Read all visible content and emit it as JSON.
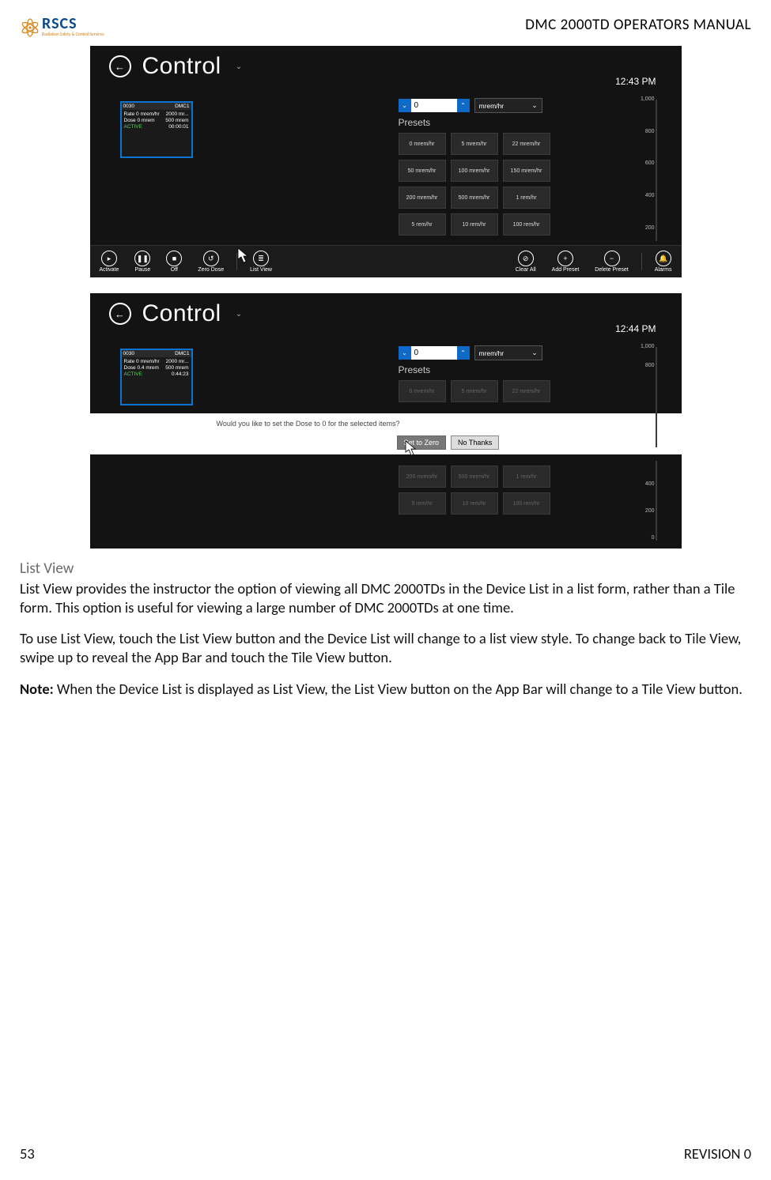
{
  "header": {
    "logo_main": "RSCS",
    "logo_sub": "Radiation Safety & Control Services",
    "doc_title": "DMC 2000TD OPERATORS MANUAL"
  },
  "screens": {
    "s1": {
      "title": "Control",
      "clock": "12:43 PM",
      "device": {
        "id": "0030",
        "model": "DMC1",
        "rate_l": "Rate 0 mrem/hr",
        "rate_r": "2000 mr...",
        "dose_l": "Dose 0 mrem",
        "dose_r": "500 mrem",
        "stat_l": "ACTIVE",
        "stat_r": "00:00:01"
      },
      "spinner_value": "0",
      "unit_value": "mrem/hr",
      "presets_label": "Presets",
      "presets": [
        "0 mrem/hr",
        "5 mrem/hr",
        "22 mrem/hr",
        "50 mrem/hr",
        "100 mrem/hr",
        "150 mrem/hr",
        "200 mrem/hr",
        "500 mrem/hr",
        "1 rem/hr",
        "5 rem/hr",
        "10 rem/hr",
        "100 rem/hr"
      ],
      "axis": [
        "1,000",
        "800",
        "600",
        "400",
        "200"
      ],
      "appbar": {
        "activate": "Activate",
        "pause": "Pause",
        "off": "Off",
        "zero": "Zero Dose",
        "list": "List View",
        "clear": "Clear All",
        "add": "Add Preset",
        "del": "Delete Preset",
        "alarms": "Alarms"
      }
    },
    "s2": {
      "title": "Control",
      "clock": "12:44 PM",
      "device": {
        "id": "0030",
        "model": "DMC1",
        "rate_l": "Rate 0 mrem/hr",
        "rate_r": "2000 mr...",
        "dose_l": "Dose 0.4 mrem",
        "dose_r": "500 mrem",
        "stat_l": "ACTIVE",
        "stat_r": "0:44:23"
      },
      "spinner_value": "0",
      "unit_value": "mrem/hr",
      "presets_label": "Presets",
      "presets_top": [
        "0 mrem/hr",
        "5 mrem/hr",
        "22 mrem/hr"
      ],
      "presets_bot": [
        "200 mrem/hr",
        "500 mrem/hr",
        "1 rem/hr",
        "5 rem/hr",
        "10 rem/hr",
        "100 rem/hr"
      ],
      "axis_top": [
        "1,000",
        "800"
      ],
      "axis_bot": [
        "400",
        "200",
        "0"
      ],
      "dialog": {
        "msg": "Would you like to set the Dose to 0 for the selected items?",
        "primary": "Set to Zero",
        "secondary": "No Thanks"
      }
    }
  },
  "section": {
    "heading": "List View",
    "p1": "List View provides the instructor the option of viewing all DMC 2000TDs in the Device List in a list form, rather than a Tile form. This option is useful for viewing a large number of DMC 2000TDs at one time.",
    "p2": "To use List View, touch the List View button and the Device List will change to a list view style. To change back to Tile View, swipe up to reveal the App Bar and touch the Tile View button.",
    "note_label": "Note:",
    "note_body": " When the Device List is displayed as List View, the List View button on the App Bar will change to a Tile View button."
  },
  "footer": {
    "page": "53",
    "rev": "REVISION 0"
  }
}
